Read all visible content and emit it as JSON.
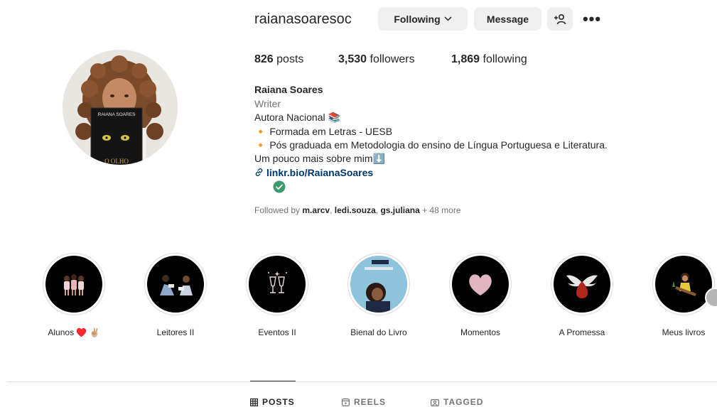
{
  "header": {
    "username": "raianasoaresoc",
    "following_label": "Following",
    "message_label": "Message",
    "more_label": "•••"
  },
  "stats": {
    "posts_count": "826",
    "posts_label": "posts",
    "followers_count": "3,530",
    "followers_label": "followers",
    "following_count": "1,869",
    "following_label": "following"
  },
  "avatar": {
    "book_title": "RAIANA SOARES",
    "book_subtitle": "O OLHO"
  },
  "bio": {
    "name": "Raiana Soares",
    "category": "Writer",
    "line1": "Autora Nacional 📚",
    "line2": "🔸 Formada em Letras - UESB",
    "line3": "🔸 Pós graduada em Metodologia do ensino de Língua Portuguesa e Literatura.",
    "line4": "Um pouco mais sobre mim⬇️",
    "link": "linkr.bio/RaianaSoares"
  },
  "followed_by": {
    "prefix": "Followed by",
    "user1": "m.arcv",
    "user2": "ledi.souza",
    "user3": "gs.juliana",
    "more": "+ 48 more"
  },
  "highlights": [
    {
      "label": "Alunos ♥️ ✌🏼"
    },
    {
      "label": "Leitores II"
    },
    {
      "label": "Eventos II"
    },
    {
      "label": "Bienal do Livro"
    },
    {
      "label": "Momentos"
    },
    {
      "label": "A Promessa"
    },
    {
      "label": "Meus livros"
    }
  ],
  "tabs": {
    "posts": "POSTS",
    "reels": "REELS",
    "tagged": "TAGGED"
  },
  "colors": {
    "link": "#00376b",
    "button_bg": "#efefef",
    "verified": "#3c9a6b",
    "muted": "#737373"
  }
}
